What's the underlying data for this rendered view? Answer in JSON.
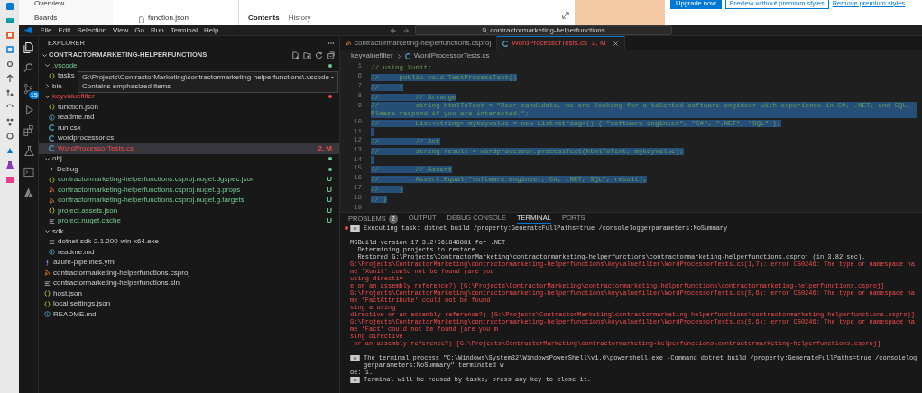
{
  "browser": {
    "nav_items": [
      "Overview",
      "Boards"
    ],
    "file_item": "function.json",
    "tabs": [
      {
        "label": "Contents",
        "selected": true
      },
      {
        "label": "History",
        "selected": false
      }
    ],
    "buttons": [
      {
        "label": "Upgrade now",
        "kind": "primary"
      },
      {
        "label": "Preview without premium styles",
        "kind": "outline"
      },
      {
        "label": "Remove premium styles",
        "kind": "link"
      }
    ]
  },
  "vscode": {
    "menu": [
      "File",
      "Edit",
      "Selection",
      "View",
      "Go",
      "Run",
      "Terminal",
      "Help"
    ],
    "search": {
      "value": "contractormarketing-helperfunctions"
    },
    "activity_bar": [
      {
        "kind": "explorer",
        "selected": true
      },
      {
        "kind": "search",
        "selected": false
      },
      {
        "kind": "source-control",
        "selected": false,
        "badge": "15"
      },
      {
        "kind": "run",
        "selected": false
      },
      {
        "kind": "extensions",
        "selected": false
      },
      {
        "kind": "testing",
        "selected": false
      },
      {
        "kind": "terminal",
        "selected": false
      },
      {
        "kind": "azure",
        "selected": false
      }
    ],
    "explorer": {
      "title": "EXPLORER",
      "project": "CONTRACTORMARKETING-HELPERFUNCTIONS",
      "tree": [
        {
          "label": ".vscode",
          "kind": "folder",
          "expanded": true,
          "untracked": true,
          "label_tinted": true,
          "children": [
            {
              "label": "tasks",
              "kind": "json"
            }
          ]
        },
        {
          "label": "bin",
          "kind": "folder",
          "expanded": false
        },
        {
          "label": "keyvaluefilter",
          "kind": "folder",
          "expanded": true,
          "has_errors": true,
          "label_tinted": true,
          "children": [
            {
              "label": "function.json",
              "kind": "json"
            },
            {
              "label": "readme.md",
              "kind": "md"
            },
            {
              "label": "run.csx",
              "kind": "cs"
            },
            {
              "label": "wordprocessor.cs",
              "kind": "cs"
            },
            {
              "label": "WordProcessorTests.cs",
              "kind": "cs",
              "selected": true,
              "has_errors": true,
              "label_tinted": true,
              "decoration": "2, M"
            }
          ]
        },
        {
          "label": "obj",
          "kind": "folder",
          "expanded": true,
          "untracked": true,
          "label_tinted": false,
          "children": [
            {
              "label": "Debug",
              "kind": "folder",
              "expanded": false,
              "untracked": true,
              "label_tinted": false
            },
            {
              "label": "contractormarketing-helperfunctions.csproj.nuget.dgspec.json",
              "kind": "json",
              "untracked": true,
              "label_tinted": true,
              "decoration": "U"
            },
            {
              "label": "contractormarketing-helperfunctions.csproj.nuget.g.props",
              "kind": "rss",
              "untracked": true,
              "label_tinted": true,
              "decoration": "U"
            },
            {
              "label": "contractormarketing-helperfunctions.csproj.nuget.g.targets",
              "kind": "rss",
              "untracked": true,
              "label_tinted": true,
              "decoration": "U"
            },
            {
              "label": "project.assets.json",
              "kind": "json",
              "untracked": true,
              "label_tinted": true,
              "decoration": "U"
            },
            {
              "label": "project.nuget.cache",
              "kind": "lines",
              "untracked": true,
              "label_tinted": true,
              "decoration": "U"
            }
          ]
        },
        {
          "label": "sdk",
          "kind": "folder",
          "expanded": true,
          "children": [
            {
              "label": "dotnet-sdk-2.1.200-win-x64.exe",
              "kind": "lines"
            },
            {
              "label": "readme.md",
              "kind": "md"
            }
          ]
        },
        {
          "label": "azure-pipelines.yml",
          "kind": "yml"
        },
        {
          "label": "contractormarketing-helperfunctions.csproj",
          "kind": "rss"
        },
        {
          "label": "contractormarketing-helperfunctions.sln",
          "kind": "lines"
        },
        {
          "label": "host.json",
          "kind": "json"
        },
        {
          "label": "local.settings.json",
          "kind": "json"
        },
        {
          "label": "README.md",
          "kind": "md"
        }
      ],
      "tooltip": [
        "G:\\Projects\\ContractorMarketing\\contractormarketing-helperfunctions\\.vscode •",
        "Contains emphasized items"
      ]
    },
    "editor": {
      "tabs": [
        {
          "label": "contractormarketing-helperfunctions.csproj",
          "kind": "rss",
          "selected": false
        },
        {
          "label": "WordProcessorTests.cs",
          "kind": "cs",
          "selected": true,
          "badge": "2, M"
        }
      ],
      "breadcrumb": [
        "keyvaluefilter",
        "WordProcessorTests.cs"
      ],
      "lines": [
        {
          "number": "1",
          "text": "// using Xunit;",
          "selected": false
        },
        {
          "number": "6",
          "text": "//     public void TestProcessText()",
          "selected": true
        },
        {
          "number": "7",
          "text": "//     {",
          "selected": true
        },
        {
          "number": "8",
          "text": "//         // Arrange",
          "selected": true
        },
        {
          "number": "9",
          "text": "//         string htmlToText = \"Dear candidate, we are looking for a talented software engineer with experience in C#, .NET, and SQL. Please respond if you are interested.\";",
          "selected": true
        },
        {
          "number": "10",
          "text": "//         List<string> mykeyvalue = new List<string>() { \"software engineer\", \"C#\", \".NET\", \"SQL\" };",
          "selected": true
        },
        {
          "number": "11",
          "selected": true
        },
        {
          "number": "12",
          "text": "//         // Act",
          "selected": true
        },
        {
          "number": "13",
          "text": "//         string result = wordprocessor.processText(htmlToText, mykeyvalue);",
          "selected": true
        },
        {
          "number": "14",
          "selected": true
        },
        {
          "number": "15",
          "text": "//         // Assert",
          "selected": true
        },
        {
          "number": "16",
          "text": "//         Assert.Equal(\"software engineer, C#, .NET, SQL\", result);",
          "selected": true
        },
        {
          "number": "17",
          "text": "//     }",
          "selected": true
        },
        {
          "number": "18",
          "text": "// }",
          "selected": true
        },
        {
          "number": "19",
          "selected": false
        }
      ]
    },
    "panel": {
      "tabs": [
        {
          "label": "PROBLEMS",
          "badge": "2",
          "selected": false
        },
        {
          "label": "OUTPUT",
          "selected": false
        },
        {
          "label": "DEBUG CONSOLE",
          "selected": false
        },
        {
          "label": "TERMINAL",
          "selected": true
        },
        {
          "label": "PORTS",
          "selected": false
        }
      ],
      "terminal": [
        {
          "kind": "task-failed",
          "text": "Executing task: dotnet build /property:GenerateFullPaths=true /consoleloggerparameters:NoSummary"
        },
        {
          "kind": "blank"
        },
        {
          "kind": "plain",
          "text": "MSBuild version 17.3.2+561848881 for .NET"
        },
        {
          "kind": "plain",
          "text": "  Determining projects to restore..."
        },
        {
          "kind": "plain",
          "text": "  Restored G:\\Projects\\ContractorMarketing\\contractormarketing-helperfunctions\\contractormarketing-helperfunctions.csproj (in 3.82 sec)."
        },
        {
          "kind": "error",
          "text": "G:\\Projects\\ContractorMarketing\\contractormarketing-helperfunctions\\keyvaluefilter\\WordProcessorTests.cs(1,7): error CS0246: The type or namespace name 'Xunit' could not be found (are you"
        },
        {
          "kind": "error",
          "text": "using directiv"
        },
        {
          "kind": "error",
          "text": "e or an assembly reference?) [G:\\Projects\\ContractorMarketing\\contractormarketing-helperfunctions\\contractormarketing-helperfunctions.csproj]"
        },
        {
          "kind": "error",
          "text": "G:\\Projects\\ContractorMarketing\\contractormarketing-helperfunctions\\keyvaluefilter\\WordProcessorTests.cs(5,6): error CS0246: The type or namespace name 'FactAttribute' could not be found"
        },
        {
          "kind": "error",
          "text": "sing a using"
        },
        {
          "kind": "error",
          "text": "directive or an assembly reference?) [G:\\Projects\\ContractorMarketing\\contractormarketing-helperfunctions\\contractormarketing-helperfunctions.csproj]"
        },
        {
          "kind": "error",
          "text": "G:\\Projects\\ContractorMarketing\\contractormarketing-helperfunctions\\keyvaluefilter\\WordProcessorTests.cs(5,6): error CS0246: The type or namespace name 'Fact' could not be found (are you m"
        },
        {
          "kind": "error",
          "text": "sing directive"
        },
        {
          "kind": "error",
          "text": " or an assembly reference?) [G:\\Projects\\ContractorMarketing\\contractormarketing-helperfunctions\\contractormarketing-helperfunctions.csproj]"
        },
        {
          "kind": "blank"
        },
        {
          "kind": "task",
          "text": "The terminal process \"C:\\Windows\\System32\\WindowsPowerShell\\v1.0\\powershell.exe -Command dotnet build /property:GenerateFullPaths=true /consoleloggerparameters:NoSummary\" terminated w"
        },
        {
          "kind": "plain",
          "text": "de: 1."
        },
        {
          "kind": "task",
          "text": "Terminal will be reused by tasks, press any key to close it."
        }
      ]
    }
  }
}
